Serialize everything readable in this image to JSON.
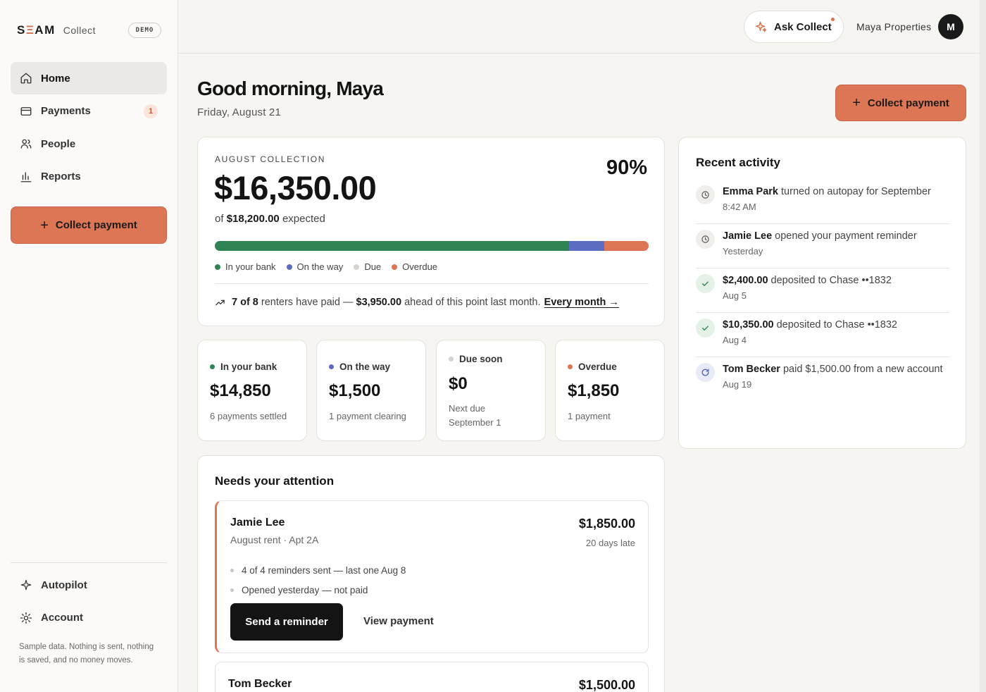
{
  "brand": {
    "name_pre": "S",
    "name_e": "Ξ",
    "name_post": "AM",
    "sub": "Collect",
    "badge": "DEMO"
  },
  "nav": {
    "items": [
      {
        "label": "Home",
        "icon": "home-icon",
        "active": true
      },
      {
        "label": "Payments",
        "icon": "card-icon",
        "badge": "1"
      },
      {
        "label": "People",
        "icon": "people-icon"
      },
      {
        "label": "Reports",
        "icon": "bar-chart-icon"
      }
    ],
    "collect_label": "Collect payment",
    "bottom": [
      {
        "label": "Autopilot",
        "icon": "sparkle-icon"
      },
      {
        "label": "Account",
        "icon": "gear-icon"
      }
    ],
    "note": "Sample data. Nothing is sent, nothing is saved, and no money moves."
  },
  "header": {
    "ask_label": "Ask Collect",
    "org": "Maya Properties",
    "avatar": "M"
  },
  "page": {
    "greeting": "Good morning, Maya",
    "date": "Friday, August 21",
    "collect_label": "Collect payment"
  },
  "summary": {
    "eyebrow": "AUGUST COLLECTION",
    "amount": "$16,350.00",
    "percent": "90%",
    "expected_pre": "of",
    "expected_amount": "$18,200.00",
    "expected_post": "expected",
    "progress": [
      {
        "key": "bank",
        "fraction": 0.8159,
        "color": "#2e8452"
      },
      {
        "key": "way",
        "fraction": 0.0824,
        "color": "#5b6cc2"
      },
      {
        "key": "overdue",
        "fraction": 0.1017,
        "color": "#dd7654"
      }
    ],
    "legend": [
      {
        "label": "In your bank",
        "color": "#2e8452"
      },
      {
        "label": "On the way",
        "color": "#5b6cc2"
      },
      {
        "label": "Due",
        "color": "#d6d3ce"
      },
      {
        "label": "Overdue",
        "color": "#dd7654"
      }
    ],
    "foot_count": "7 of 8",
    "foot_mid": "renters have paid —",
    "foot_amount": "$3,950.00",
    "foot_post": "ahead of this point last month.",
    "foot_link": "Every month →"
  },
  "stats": [
    {
      "title": "In your bank",
      "value": "$14,850",
      "sub": "6 payments settled",
      "color": "#2e8452"
    },
    {
      "title": "On the way",
      "value": "$1,500",
      "sub": "1 payment clearing",
      "color": "#5b6cc2"
    },
    {
      "title": "Due soon",
      "value": "$0",
      "sub": "Next due September 1",
      "color": "#d6d3ce"
    },
    {
      "title": "Overdue",
      "value": "$1,850",
      "sub": "1 payment",
      "color": "#dd7654"
    }
  ],
  "attention": {
    "title": "Needs your attention",
    "items": [
      {
        "name": "Jamie Lee",
        "desc": "August rent · Apt 2A",
        "amount": "$1,850.00",
        "late": "20 days late",
        "bullets": [
          "4 of 4 reminders sent — last one Aug 8",
          "Opened yesterday — not paid"
        ],
        "primary": "Send a reminder",
        "secondary": "View payment"
      },
      {
        "name": "Tom Becker",
        "amount": "$1,500.00"
      }
    ]
  },
  "activity": {
    "title": "Recent activity",
    "items": [
      {
        "bold": "Emma Park",
        "text": " turned on autopay for September",
        "time": "8:42 AM",
        "kind": "neutral",
        "icon": "clock-icon"
      },
      {
        "bold": "Jamie Lee",
        "text": " opened your payment reminder",
        "time": "Yesterday",
        "kind": "neutral",
        "icon": "clock-icon"
      },
      {
        "bold": "$2,400.00",
        "text": " deposited to Chase ••1832",
        "time": "Aug 5",
        "kind": "ok",
        "icon": "check-icon"
      },
      {
        "bold": "$10,350.00",
        "text": " deposited to Chase ••1832",
        "time": "Aug 4",
        "kind": "ok",
        "icon": "check-icon"
      },
      {
        "bold": "Tom Becker",
        "text": " paid $1,500.00 from a new account",
        "time": "Aug 19",
        "kind": "pend",
        "icon": "refresh-icon"
      }
    ]
  }
}
